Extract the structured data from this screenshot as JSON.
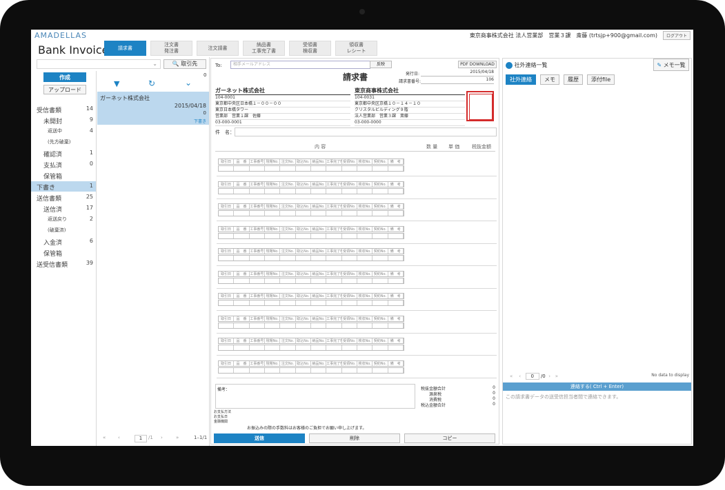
{
  "app": {
    "logo": "AMADELLAS",
    "title": "Bank Invoice",
    "user_info": "東京商事株式会社 法人営業部　営業３課　斎藤 (trtsjp+900@gmail.com)",
    "logout": "ログアウト",
    "tabs": [
      {
        "label": "請求書",
        "active": true
      },
      {
        "label": "注文書\n発注書",
        "active": false
      },
      {
        "label": "注文請書",
        "active": false
      },
      {
        "label": "納品書\n工事完了書",
        "active": false
      },
      {
        "label": "受領書\n検収書",
        "active": false
      },
      {
        "label": "領収書\nレシート",
        "active": false
      }
    ]
  },
  "left": {
    "search_placeholder": "",
    "client_button": "取引先",
    "create_button": "作成",
    "upload_button": "アップロード",
    "count_top": "0",
    "nav": [
      {
        "label": "受信書類",
        "count": "14",
        "level": 0
      },
      {
        "label": "未開封",
        "count": "9",
        "level": 1
      },
      {
        "label": "返送中",
        "count": "4",
        "level": 2
      },
      {
        "label": "(先方破棄)",
        "count": "",
        "level": 2
      },
      {
        "label": "確認済",
        "count": "1",
        "level": 1
      },
      {
        "label": "支払済",
        "count": "0",
        "level": 1
      },
      {
        "label": "保管箱",
        "count": "",
        "level": 1
      },
      {
        "label": "下書き",
        "count": "1",
        "level": 0,
        "active": true
      },
      {
        "label": "送信書類",
        "count": "25",
        "level": 0
      },
      {
        "label": "送信済",
        "count": "17",
        "level": 1
      },
      {
        "label": "返送戻り",
        "count": "2",
        "level": 2
      },
      {
        "label": "(破棄済)",
        "count": "",
        "level": 2
      },
      {
        "label": "入金済",
        "count": "6",
        "level": 1
      },
      {
        "label": "保管箱",
        "count": "",
        "level": 1
      },
      {
        "label": "送受信書類",
        "count": "39",
        "level": 0
      }
    ],
    "list_item": {
      "company": "ガーネット株式会社",
      "date": "2015/04/18",
      "amount": "0",
      "status": "下書き"
    },
    "pager": {
      "page": "1",
      "total": "/1",
      "range": "1–1/1"
    }
  },
  "doc": {
    "to_label": "To:",
    "to_placeholder": "相手メールアドレス",
    "reflect_button": "反映",
    "pdf_button": "PDF DOWNLOAD",
    "heading": "請求書",
    "issue_date_label": "発行日:",
    "issue_date": "2015/04/18",
    "invoice_no_label": "請求書番号:",
    "invoice_no": "106",
    "to_company": {
      "name": "ガーネット株式会社",
      "zip": "104-0001",
      "addr1": "東京都中央区日本橋１－００－００",
      "addr2": "東京日本橋タワー",
      "dept": "営業部　営業１課　佐藤",
      "tel": "03-000-0001"
    },
    "from_company": {
      "name": "東京商事株式会社",
      "zip": "104-0031",
      "addr1": "東京都中央区京橋１０－１４－１０",
      "addr2": "クリスタルビルディング９階",
      "dept": "法人営業部　営業３課　斎藤",
      "tel": "03-000-0000"
    },
    "subject_label": "件　名：",
    "columns": {
      "content": "内 容",
      "qty": "数 量",
      "unit": "単 価",
      "amount": "税抜金額"
    },
    "row_cells": [
      "取引日",
      "品　番",
      "工事番号",
      "現場No.",
      "注文No.",
      "取込No.",
      "納品No.",
      "工事完了No.",
      "受領No.",
      "検収No.",
      "契約No.",
      "備　考"
    ],
    "remarks_label": "備考：",
    "totals": [
      {
        "label": "税抜金額合計",
        "value": "0"
      },
      {
        "label": "源泉税",
        "value": "0"
      },
      {
        "label": "消費税",
        "value": "0"
      },
      {
        "label": "税込金額合計",
        "value": "0"
      }
    ],
    "payment_lines": [
      "お支払方法",
      "お支払日",
      "金融機関"
    ],
    "fee_note": "お振込みの際の手数料はお客様のご負担でお願い申し上げます。",
    "send_button": "送信",
    "delete_button": "削除",
    "copy_button": "コピー"
  },
  "right": {
    "contacts_title": "社外連絡一覧",
    "memo_list": "メモ一覧",
    "tabs": [
      "社外連絡",
      "メモ",
      "履歴",
      "添付file"
    ],
    "no_data": "No data to display",
    "pager_page": "0",
    "pager_total": "/0",
    "contact_button": "連絡する( Ctrl + Enter)",
    "contact_placeholder": "この請求書データの送受信担当者間で連絡できます。"
  }
}
